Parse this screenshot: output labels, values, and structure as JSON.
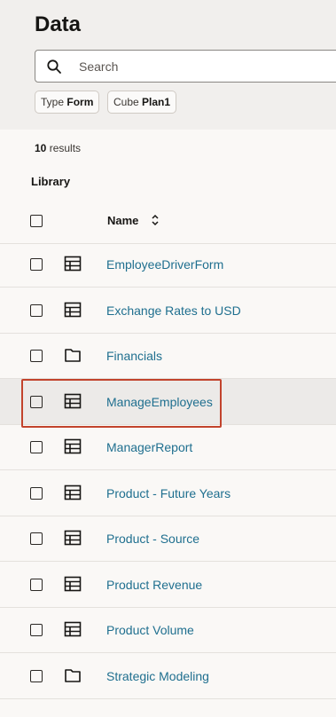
{
  "page": {
    "title": "Data"
  },
  "search": {
    "placeholder": "Search"
  },
  "filters": [
    {
      "key": "Type",
      "value": "Form"
    },
    {
      "key": "Cube",
      "value": "Plan1"
    }
  ],
  "results": {
    "count": "10",
    "suffix": "results"
  },
  "section_label": "Library",
  "table": {
    "name_header": "Name"
  },
  "items": [
    {
      "name": "EmployeeDriverForm",
      "icon": "form-icon"
    },
    {
      "name": "Exchange Rates to USD",
      "icon": "form-icon"
    },
    {
      "name": "Financials",
      "icon": "folder-icon"
    },
    {
      "name": "ManageEmployees",
      "icon": "form-icon",
      "highlighted": true
    },
    {
      "name": "ManagerReport",
      "icon": "form-icon"
    },
    {
      "name": "Product - Future Years",
      "icon": "form-icon"
    },
    {
      "name": "Product - Source",
      "icon": "form-icon"
    },
    {
      "name": "Product Revenue",
      "icon": "form-icon"
    },
    {
      "name": "Product Volume",
      "icon": "form-icon"
    },
    {
      "name": "Strategic Modeling",
      "icon": "folder-icon"
    }
  ],
  "colors": {
    "link": "#1f6f8f",
    "highlight": "#c2432c",
    "header_bg": "#f1efed"
  }
}
